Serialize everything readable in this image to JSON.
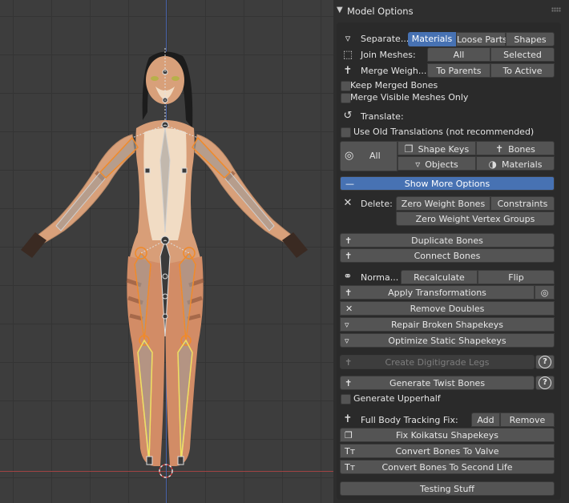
{
  "panel": {
    "title": "Model Options"
  },
  "separate": {
    "label": "Separate...",
    "options": [
      "Materials",
      "Loose Parts",
      "Shapes"
    ]
  },
  "join": {
    "label": "Join Meshes:",
    "all": "All",
    "selected": "Selected"
  },
  "merge": {
    "label": "Merge Weigh...",
    "to_parents": "To Parents",
    "to_active": "To Active"
  },
  "checks": {
    "keep_merged": "Keep Merged Bones",
    "merge_visible": "Merge Visible Meshes Only",
    "old_translations": "Use Old Translations (not recommended)",
    "upperhalf": "Generate Upperhalf"
  },
  "translate": {
    "label": "Translate:",
    "all": "All",
    "shape_keys": "Shape Keys",
    "bones": "Bones",
    "objects": "Objects",
    "materials": "Materials"
  },
  "show_more": "Show More Options",
  "delete": {
    "label": "Delete:",
    "zero_weight_bones": "Zero Weight Bones",
    "constraints": "Constraints",
    "zero_weight_groups": "Zero Weight Vertex Groups"
  },
  "bones_ops": {
    "duplicate": "Duplicate Bones",
    "connect": "Connect Bones"
  },
  "normals": {
    "label": "Norma...",
    "recalculate": "Recalculate",
    "flip": "Flip"
  },
  "ops": {
    "apply_transformations": "Apply Transformations",
    "remove_doubles": "Remove Doubles",
    "repair_shapekeys": "Repair Broken Shapekeys",
    "optimize_shapekeys": "Optimize Static Shapekeys",
    "digitigrade": "Create Digitigrade Legs",
    "twist_bones": "Generate Twist Bones"
  },
  "fbt": {
    "label": "Full Body Tracking Fix:",
    "add": "Add",
    "remove": "Remove"
  },
  "convert": {
    "koikatsu": "Fix Koikatsu Shapekeys",
    "valve": "Convert Bones To Valve",
    "second_life": "Convert Bones To Second Life"
  },
  "testing": "Testing Stuff",
  "help_glyph": "?"
}
